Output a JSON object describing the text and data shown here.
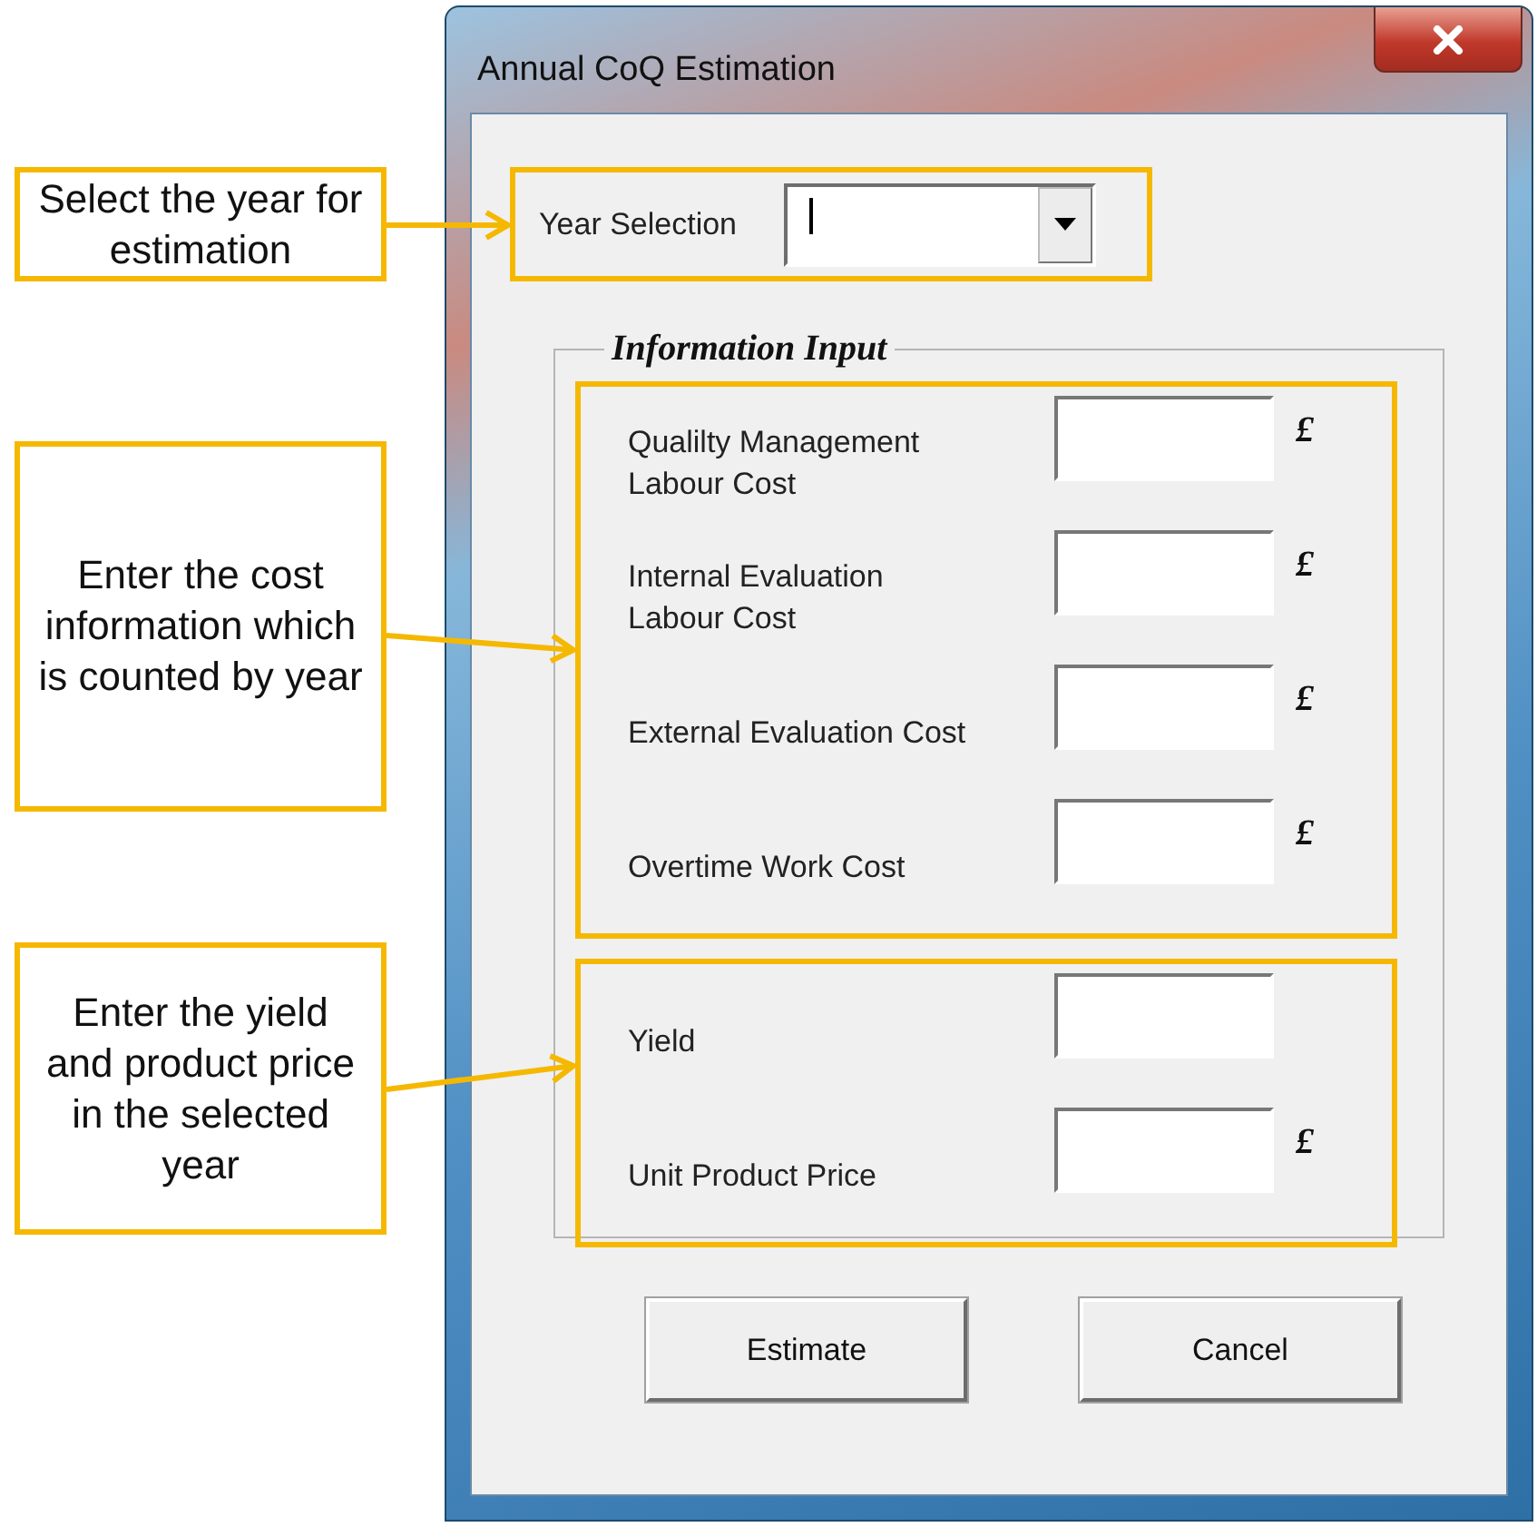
{
  "window": {
    "title": "Annual CoQ Estimation"
  },
  "year_selection": {
    "label": "Year Selection",
    "focused": true
  },
  "group": {
    "title": "Information Input",
    "sections": [
      {
        "fields": [
          {
            "label": "Qualilty Management\nLabour Cost",
            "unit": "£"
          },
          {
            "label": "Internal Evaluation\nLabour Cost",
            "unit": "£"
          },
          {
            "label": "External Evaluation Cost",
            "unit": "£"
          },
          {
            "label": "Overtime Work Cost",
            "unit": "£"
          }
        ]
      },
      {
        "fields": [
          {
            "label": "Yield"
          },
          {
            "label": "Unit Product Price",
            "unit": "£"
          }
        ]
      }
    ]
  },
  "buttons": [
    "Estimate",
    "Cancel"
  ],
  "annotations": [
    {
      "text": "Select the year for estimation"
    },
    {
      "text": "Enter the cost information which is counted by year"
    },
    {
      "text": "Enter the yield and product price in the selected year"
    }
  ]
}
